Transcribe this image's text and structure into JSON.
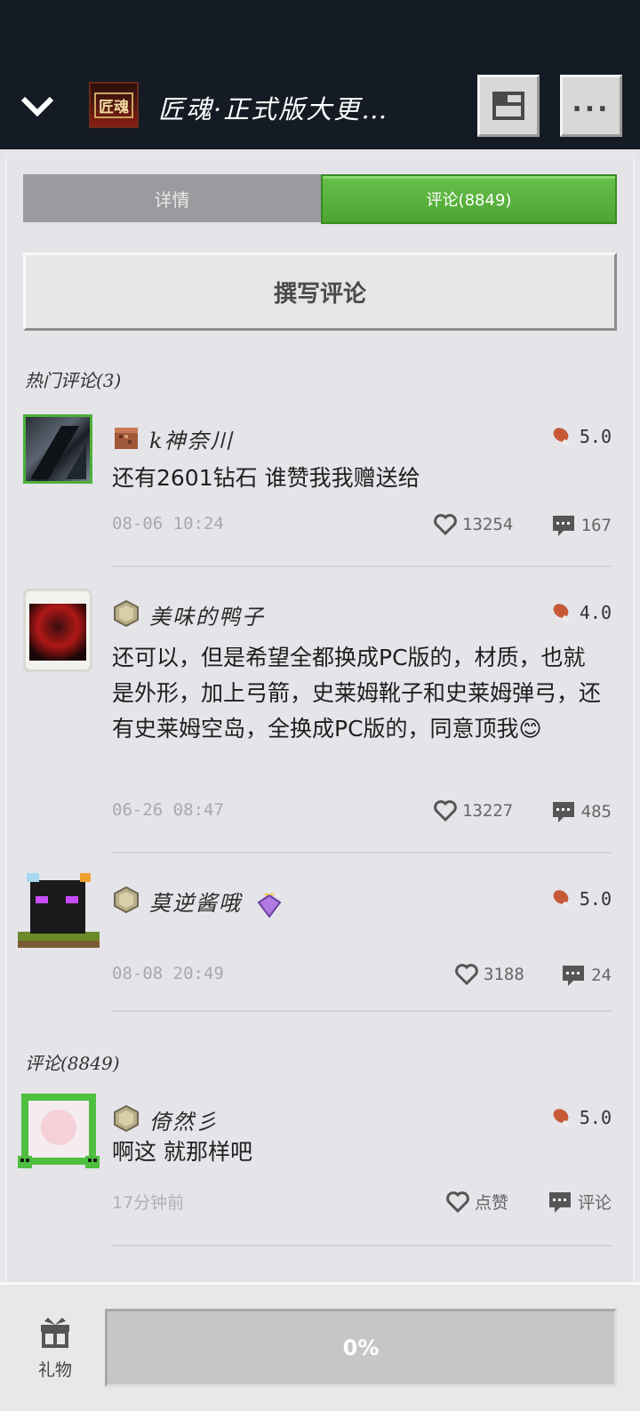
{
  "header": {
    "title": "匠魂·正式版大更…",
    "app_icon_text": "匠魂"
  },
  "tabs": {
    "details": "详情",
    "comments": "评论(8849)"
  },
  "write_comment": "撰写评论",
  "hot_section": "热门评论(3)",
  "all_section": "评论(8849)",
  "comments": [
    {
      "user": "k神奈川",
      "rating": "5.0",
      "text": "还有2601钻石 谁赞我我赠送给",
      "time": "08-06 10:24",
      "likes": "13254",
      "replies": "167"
    },
    {
      "user": "美味的鸭子",
      "rating": "4.0",
      "text": "还可以，但是希望全都换成PC版的，材质，也就是外形，加上弓箭，史莱姆靴子和史莱姆弹弓，还有史莱姆空岛，全换成PC版的，同意顶我😊",
      "time": "06-26 08:47",
      "likes": "13227",
      "replies": "485"
    },
    {
      "user": "莫逆酱哦",
      "rating": "5.0",
      "text": "",
      "time": "08-08 20:49",
      "likes": "3188",
      "replies": "24"
    },
    {
      "user": "倚然彡",
      "rating": "5.0",
      "text": "啊这  就那样吧",
      "time": "17分钟前",
      "likes": "点赞",
      "replies": "评论"
    }
  ],
  "bottom": {
    "gift_label": "礼物",
    "progress": "0%"
  },
  "colors": {
    "header_bg": "#141b24",
    "tab_active": "#4ca532",
    "tab_inactive": "#9b9b9f"
  }
}
